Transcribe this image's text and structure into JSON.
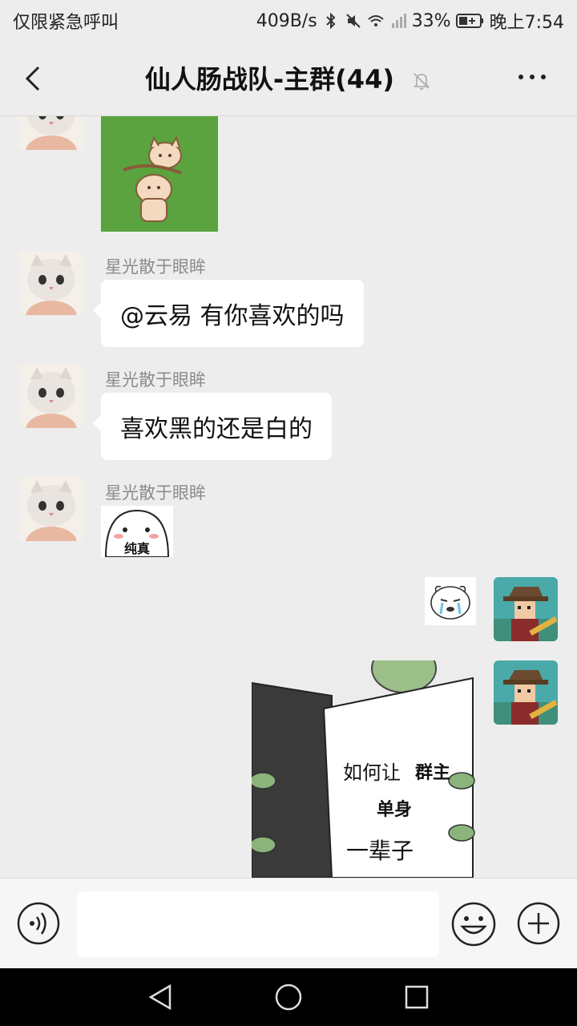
{
  "status_bar": {
    "left_text": "仅限紧急呼叫",
    "net_speed": "409B/s",
    "battery": "33%",
    "time": "晚上7:54"
  },
  "header": {
    "title": "仙人肠战队-主群(44)"
  },
  "messages": [
    {
      "type": "sticker",
      "side": "left",
      "sticker": "cat-shield-sticker"
    },
    {
      "type": "text",
      "side": "left",
      "sender": "星光散于眼眸",
      "text": "@云易  有你喜欢的吗"
    },
    {
      "type": "text",
      "side": "left",
      "sender": "星光散于眼眸",
      "text": "喜欢黑的还是白的"
    },
    {
      "type": "sticker",
      "side": "left",
      "sender": "星光散于眼眸",
      "sticker": "pure-ghost-sticker",
      "caption": "纯真"
    },
    {
      "type": "sticker",
      "side": "right",
      "sticker": "crying-bear-sticker"
    },
    {
      "type": "image",
      "side": "right",
      "sticker": "book-meme",
      "lines": [
        "如何让",
        "群主",
        "单身",
        "一辈子"
      ]
    }
  ],
  "icons": {
    "back": "chevron-left-icon",
    "mute": "bell-off-icon",
    "more": "more-icon",
    "voice": "voice-icon",
    "emoji": "emoji-icon",
    "plus": "plus-icon"
  },
  "colors": {
    "chat_bg": "#ededed",
    "bubble_bg": "#ffffff",
    "sticker_green": "#5aa33e"
  }
}
